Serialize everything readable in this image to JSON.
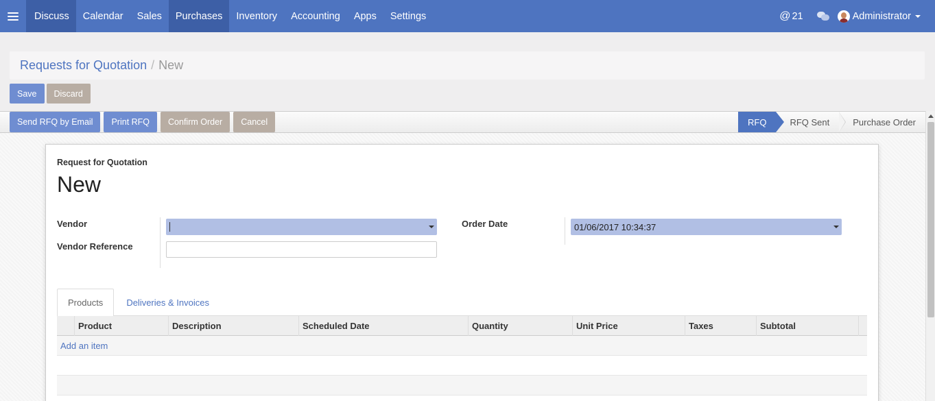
{
  "navbar": {
    "menu": [
      "Discuss",
      "Calendar",
      "Sales",
      "Purchases",
      "Inventory",
      "Accounting",
      "Apps",
      "Settings"
    ],
    "mentions_count": "21",
    "user_name": "Administrator"
  },
  "breadcrumb": {
    "parent": "Requests for Quotation",
    "separator": "/",
    "current": "New"
  },
  "control_buttons": {
    "save": "Save",
    "discard": "Discard"
  },
  "statusbar": {
    "buttons": [
      "Send RFQ by Email",
      "Print RFQ",
      "Confirm Order",
      "Cancel"
    ],
    "stages": [
      "RFQ",
      "RFQ Sent",
      "Purchase Order"
    ],
    "current_stage": "RFQ"
  },
  "form": {
    "doc_type_label": "Request for Quotation",
    "title": "New",
    "vendor_label": "Vendor",
    "vendor_value": "",
    "vendor_reference_label": "Vendor Reference",
    "vendor_reference_value": "",
    "order_date_label": "Order Date",
    "order_date_value": "01/06/2017 10:34:37"
  },
  "tabs": [
    "Products",
    "Deliveries & Invoices"
  ],
  "table": {
    "columns": [
      "Product",
      "Description",
      "Scheduled Date",
      "Quantity",
      "Unit Price",
      "Taxes",
      "Subtotal"
    ],
    "add_item": "Add an item"
  },
  "colors": {
    "brand": "#4e74c0",
    "primary_button": "#6f8dd1",
    "secondary_button": "#b8ada3"
  },
  "icons": {
    "menu": "hamburger-icon",
    "mentions": "at-icon",
    "chat": "chat-icon",
    "user": "avatar"
  }
}
